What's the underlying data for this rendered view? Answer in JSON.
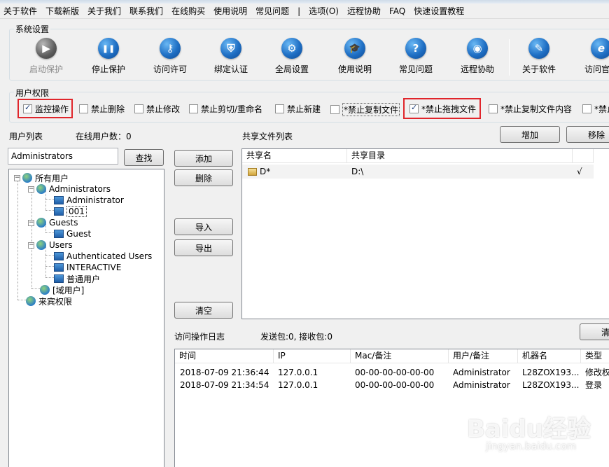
{
  "menu": [
    "关于软件",
    "下载新版",
    "关于我们",
    "联系我们",
    "在线购买",
    "使用说明",
    "常见问题",
    "|",
    "选项(O)",
    "远程协助",
    "FAQ",
    "快速设置教程"
  ],
  "system": {
    "legend": "系统设置",
    "items": [
      {
        "label": "启动保护",
        "icon": "play-icon",
        "glyph": "▶"
      },
      {
        "label": "停止保护",
        "icon": "pause-icon",
        "glyph": "❚❚"
      },
      {
        "label": "访问许可",
        "icon": "key-icon",
        "glyph": "⚷"
      },
      {
        "label": "绑定认证",
        "icon": "shield-icon",
        "glyph": "⛨"
      },
      {
        "label": "全局设置",
        "icon": "gear-icon",
        "glyph": "⚙"
      },
      {
        "label": "使用说明",
        "icon": "graduation-cap-icon",
        "glyph": "🎓"
      },
      {
        "label": "常见问题",
        "icon": "question-icon",
        "glyph": "?"
      },
      {
        "label": "远程协助",
        "icon": "globe-hand-icon",
        "glyph": "◉"
      },
      {
        "label": "关于软件",
        "icon": "document-pen-icon",
        "glyph": "✎"
      },
      {
        "label": "访问官网",
        "icon": "browser-e-icon",
        "glyph": "e"
      }
    ]
  },
  "perms": {
    "legend": "用户权限",
    "items": [
      {
        "label": "监控操作",
        "checked": true
      },
      {
        "label": "禁止删除",
        "checked": false
      },
      {
        "label": "禁止修改",
        "checked": false
      },
      {
        "label": "禁止剪切/重命名",
        "checked": false
      },
      {
        "label": "禁止新建",
        "checked": false
      },
      {
        "label": "*禁止复制文件",
        "checked": false
      },
      {
        "label": "*禁止拖拽文件",
        "checked": true
      },
      {
        "label": "*禁止复制文件内容",
        "checked": false
      },
      {
        "label": "*禁止",
        "checked": false
      }
    ]
  },
  "users": {
    "title": "用户列表",
    "online": "在线用户数：0",
    "search_value": "Administrators",
    "search_button": "查找"
  },
  "tree": [
    {
      "label": "所有用户",
      "type": "globe"
    },
    {
      "label": "Administrators",
      "type": "globe"
    },
    {
      "label": "Administrator",
      "type": "user"
    },
    {
      "label": "001",
      "type": "user"
    },
    {
      "label": "Guests",
      "type": "globe"
    },
    {
      "label": "Guest",
      "type": "user"
    },
    {
      "label": "Users",
      "type": "globe"
    },
    {
      "label": "Authenticated Users",
      "type": "user"
    },
    {
      "label": "INTERACTIVE",
      "type": "user"
    },
    {
      "label": "普通用户",
      "type": "user"
    },
    {
      "label": "[域用户]",
      "type": "globe"
    },
    {
      "label": "来宾权限",
      "type": "globe"
    }
  ],
  "mid_buttons": {
    "add": "添加",
    "delete": "删除",
    "import": "导入",
    "export": "导出",
    "clear": "清空"
  },
  "share": {
    "title": "共享文件列表",
    "add": "增加",
    "remove": "移除",
    "columns": [
      "共享名",
      "共享目录"
    ],
    "rows": [
      {
        "name": "D*",
        "dir": "D:\\",
        "flag": "√"
      }
    ]
  },
  "log": {
    "title": "访问操作日志",
    "stats": "发送包:0, 接收包:0",
    "clear": "清",
    "columns": [
      "时间",
      "IP",
      "Mac/备注",
      "用户/备注",
      "机器名",
      "类型"
    ],
    "rows": [
      [
        "2018-07-09 21:36:44",
        "127.0.0.1",
        "00-00-00-00-00-00",
        "Administrator",
        "L28ZOX193...",
        "修改权"
      ],
      [
        "2018-07-09 21:34:54",
        "127.0.0.1",
        "00-00-00-00-00-00",
        "Administrator",
        "L28ZOX193...",
        "登录"
      ]
    ]
  },
  "watermark": {
    "logo": "Baidu经验",
    "url": "jingyan.baidu.com"
  }
}
